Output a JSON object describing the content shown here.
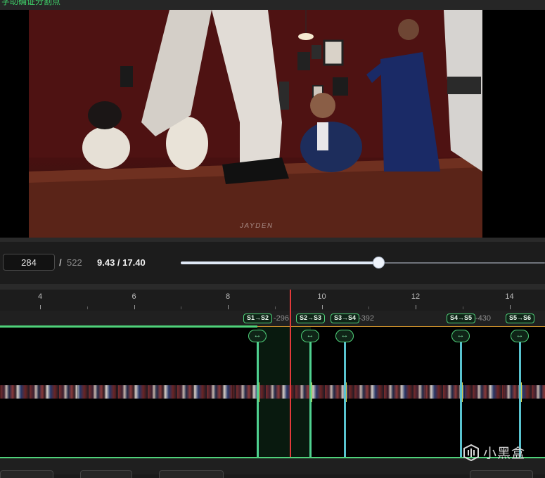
{
  "header": {
    "hint": "字助确证分割点"
  },
  "video": {
    "watermark": "JAYDEN"
  },
  "playback": {
    "frame_value": "284",
    "frame_separator": "/",
    "frame_total": "522",
    "time_readout": "9.43 / 17.40",
    "seek_progress": 0.542
  },
  "timeline": {
    "ruler_labels": [
      "4",
      "6",
      "8",
      "10",
      "12",
      "14"
    ],
    "segments": [
      {
        "label": "S1→S2",
        "frame": "-296"
      },
      {
        "label": "S2→S3",
        "frame": ""
      },
      {
        "label": "S3→S4",
        "frame": "-392"
      },
      {
        "label": "S4→S5",
        "frame": "-430"
      },
      {
        "label": "S5→S6",
        "frame": ""
      }
    ],
    "swap_icon": "↔"
  },
  "watermark_logo": {
    "text": "小黑盒"
  },
  "colors": {
    "accent_green": "#4fd27a",
    "playhead": "#e23a3a",
    "segment_line_alt": "#59c3cf",
    "orange_track": "#c58b2a"
  },
  "icons": [
    "swap-horizontal-icon",
    "heybox-logo-icon"
  ]
}
